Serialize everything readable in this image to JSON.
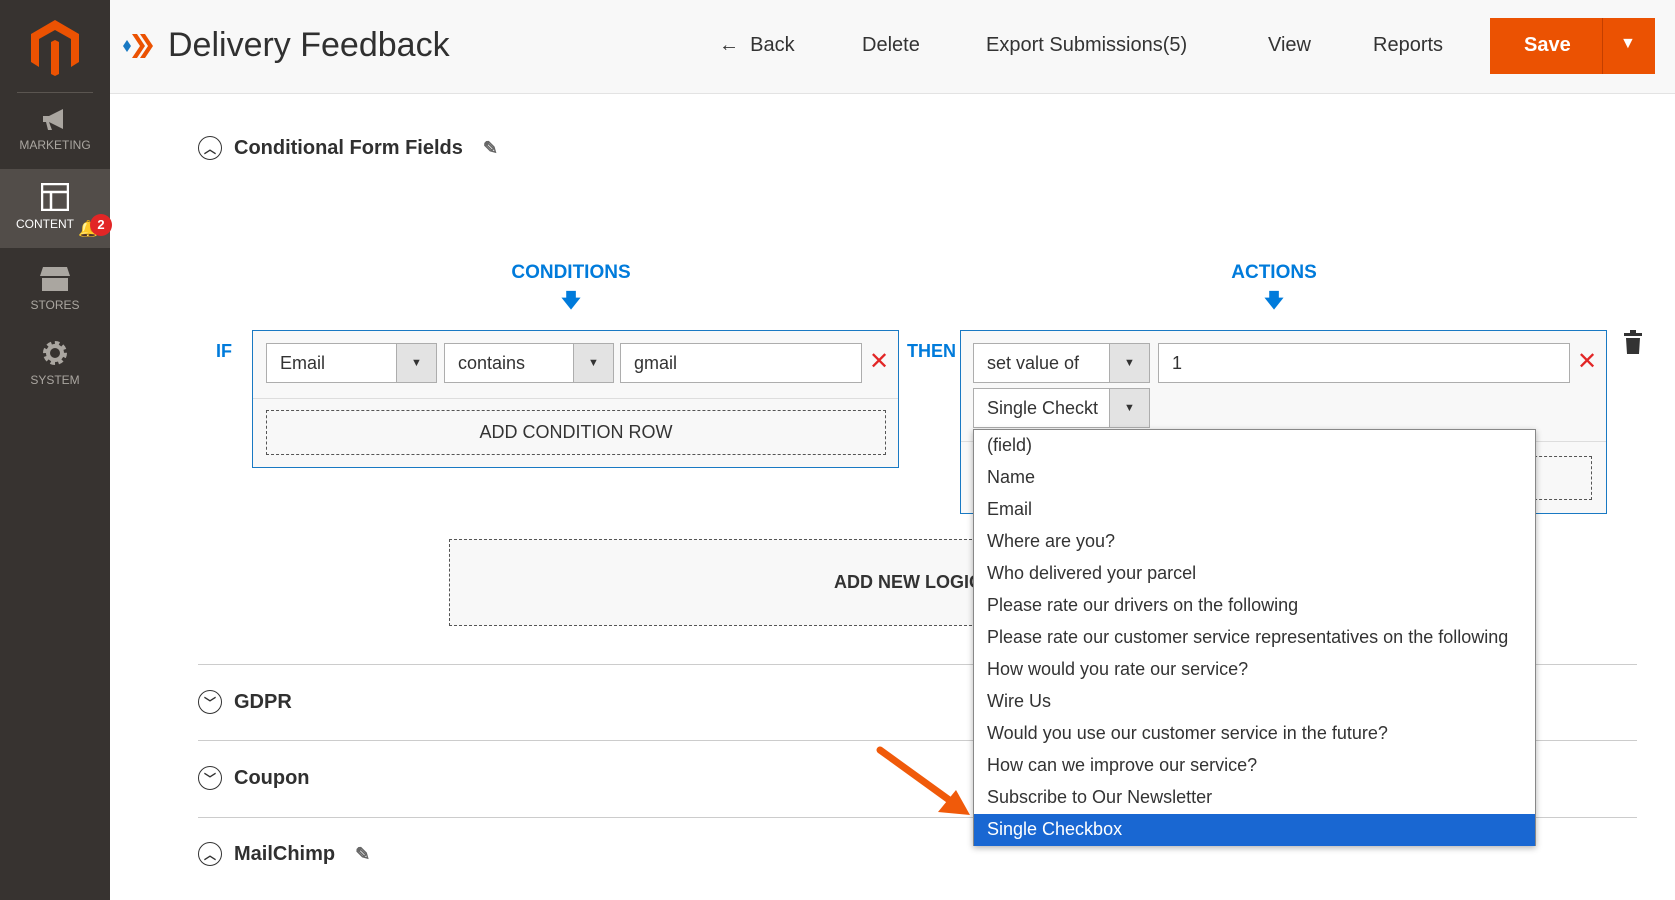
{
  "sidebar": {
    "items": [
      {
        "label": "MARKETING",
        "icon": "megaphone-icon"
      },
      {
        "label": "CONTENT",
        "icon": "layout-icon",
        "active": true,
        "badge": "2"
      },
      {
        "label": "STORES",
        "icon": "store-icon"
      },
      {
        "label": "SYSTEM",
        "icon": "gear-icon"
      }
    ]
  },
  "header": {
    "title": "Delivery Feedback",
    "back": "Back",
    "delete": "Delete",
    "export": "Export Submissions(5)",
    "view": "View",
    "reports": "Reports",
    "save": "Save"
  },
  "sections": {
    "conditional": "Conditional Form Fields",
    "gdpr": "GDPR",
    "coupon": "Coupon",
    "mailchimp": "MailChimp"
  },
  "logic": {
    "conditions_label": "CONDITIONS",
    "actions_label": "ACTIONS",
    "if_label": "IF",
    "then_label": "THEN",
    "condition": {
      "field": "Email",
      "operator": "contains",
      "value": "gmail"
    },
    "add_condition_row": "ADD CONDITION ROW",
    "action": {
      "type": "set value of",
      "value": "1",
      "field": "Single Checkt"
    },
    "add_new_logic": "ADD NEW LOGIC"
  },
  "dropdown": {
    "options": [
      "(field)",
      "Name",
      "Email",
      "Where are you?",
      "Who delivered your parcel",
      "Please rate our drivers on the following",
      "Please rate our customer service representatives on the following",
      "How would you rate our service?",
      "Wire Us",
      "Would you use our customer service in the future?",
      "How can we improve our service?",
      "Subscribe to Our Newsletter",
      "Single Checkbox"
    ],
    "selected": "Single Checkbox"
  },
  "colors": {
    "accent": "#eb5202",
    "link": "#007bdb",
    "selection": "#1967d2",
    "sidebar": "#373330"
  }
}
